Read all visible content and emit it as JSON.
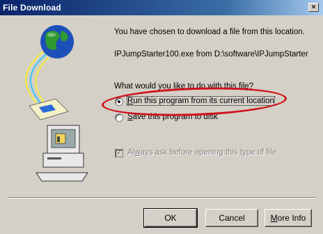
{
  "window": {
    "title": "File Download",
    "close_glyph": "×"
  },
  "message": {
    "line1": "You have chosen to download a file from this location.",
    "source": "IPJumpStarter100.exe from D:\\software\\IPJumpStarter"
  },
  "question": "What would you like to do with this file?",
  "options": [
    {
      "accel": "R",
      "rest": "un this program from its current location",
      "selected": true
    },
    {
      "accel": "S",
      "rest": "ave this program to disk",
      "selected": false
    }
  ],
  "always_ask": {
    "pre": "Al",
    "accel": "w",
    "rest": "ays ask before opening this type of file",
    "checked": true,
    "disabled": true
  },
  "buttons": {
    "ok": "OK",
    "cancel": "Cancel",
    "more_accel": "M",
    "more_rest": "ore Info"
  },
  "colors": {
    "title_gradient_start": "#0a246a",
    "face": "#d4d0c8",
    "highlight_ellipse": "#d0121b"
  },
  "icons": [
    "globe-icon",
    "document-icon",
    "computer-icon"
  ]
}
